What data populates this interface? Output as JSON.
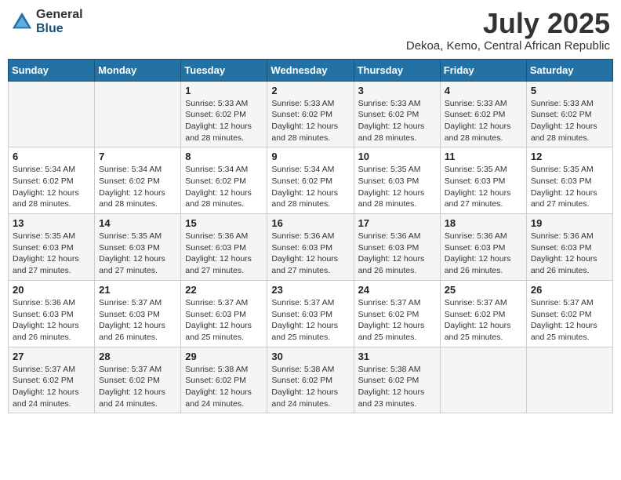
{
  "logo": {
    "general": "General",
    "blue": "Blue"
  },
  "title": "July 2025",
  "subtitle": "Dekoa, Kemo, Central African Republic",
  "weekdays": [
    "Sunday",
    "Monday",
    "Tuesday",
    "Wednesday",
    "Thursday",
    "Friday",
    "Saturday"
  ],
  "weeks": [
    [
      {
        "day": "",
        "info": ""
      },
      {
        "day": "",
        "info": ""
      },
      {
        "day": "1",
        "sunrise": "Sunrise: 5:33 AM",
        "sunset": "Sunset: 6:02 PM",
        "daylight": "Daylight: 12 hours and 28 minutes."
      },
      {
        "day": "2",
        "sunrise": "Sunrise: 5:33 AM",
        "sunset": "Sunset: 6:02 PM",
        "daylight": "Daylight: 12 hours and 28 minutes."
      },
      {
        "day": "3",
        "sunrise": "Sunrise: 5:33 AM",
        "sunset": "Sunset: 6:02 PM",
        "daylight": "Daylight: 12 hours and 28 minutes."
      },
      {
        "day": "4",
        "sunrise": "Sunrise: 5:33 AM",
        "sunset": "Sunset: 6:02 PM",
        "daylight": "Daylight: 12 hours and 28 minutes."
      },
      {
        "day": "5",
        "sunrise": "Sunrise: 5:33 AM",
        "sunset": "Sunset: 6:02 PM",
        "daylight": "Daylight: 12 hours and 28 minutes."
      }
    ],
    [
      {
        "day": "6",
        "sunrise": "Sunrise: 5:34 AM",
        "sunset": "Sunset: 6:02 PM",
        "daylight": "Daylight: 12 hours and 28 minutes."
      },
      {
        "day": "7",
        "sunrise": "Sunrise: 5:34 AM",
        "sunset": "Sunset: 6:02 PM",
        "daylight": "Daylight: 12 hours and 28 minutes."
      },
      {
        "day": "8",
        "sunrise": "Sunrise: 5:34 AM",
        "sunset": "Sunset: 6:02 PM",
        "daylight": "Daylight: 12 hours and 28 minutes."
      },
      {
        "day": "9",
        "sunrise": "Sunrise: 5:34 AM",
        "sunset": "Sunset: 6:02 PM",
        "daylight": "Daylight: 12 hours and 28 minutes."
      },
      {
        "day": "10",
        "sunrise": "Sunrise: 5:35 AM",
        "sunset": "Sunset: 6:03 PM",
        "daylight": "Daylight: 12 hours and 28 minutes."
      },
      {
        "day": "11",
        "sunrise": "Sunrise: 5:35 AM",
        "sunset": "Sunset: 6:03 PM",
        "daylight": "Daylight: 12 hours and 27 minutes."
      },
      {
        "day": "12",
        "sunrise": "Sunrise: 5:35 AM",
        "sunset": "Sunset: 6:03 PM",
        "daylight": "Daylight: 12 hours and 27 minutes."
      }
    ],
    [
      {
        "day": "13",
        "sunrise": "Sunrise: 5:35 AM",
        "sunset": "Sunset: 6:03 PM",
        "daylight": "Daylight: 12 hours and 27 minutes."
      },
      {
        "day": "14",
        "sunrise": "Sunrise: 5:35 AM",
        "sunset": "Sunset: 6:03 PM",
        "daylight": "Daylight: 12 hours and 27 minutes."
      },
      {
        "day": "15",
        "sunrise": "Sunrise: 5:36 AM",
        "sunset": "Sunset: 6:03 PM",
        "daylight": "Daylight: 12 hours and 27 minutes."
      },
      {
        "day": "16",
        "sunrise": "Sunrise: 5:36 AM",
        "sunset": "Sunset: 6:03 PM",
        "daylight": "Daylight: 12 hours and 27 minutes."
      },
      {
        "day": "17",
        "sunrise": "Sunrise: 5:36 AM",
        "sunset": "Sunset: 6:03 PM",
        "daylight": "Daylight: 12 hours and 26 minutes."
      },
      {
        "day": "18",
        "sunrise": "Sunrise: 5:36 AM",
        "sunset": "Sunset: 6:03 PM",
        "daylight": "Daylight: 12 hours and 26 minutes."
      },
      {
        "day": "19",
        "sunrise": "Sunrise: 5:36 AM",
        "sunset": "Sunset: 6:03 PM",
        "daylight": "Daylight: 12 hours and 26 minutes."
      }
    ],
    [
      {
        "day": "20",
        "sunrise": "Sunrise: 5:36 AM",
        "sunset": "Sunset: 6:03 PM",
        "daylight": "Daylight: 12 hours and 26 minutes."
      },
      {
        "day": "21",
        "sunrise": "Sunrise: 5:37 AM",
        "sunset": "Sunset: 6:03 PM",
        "daylight": "Daylight: 12 hours and 26 minutes."
      },
      {
        "day": "22",
        "sunrise": "Sunrise: 5:37 AM",
        "sunset": "Sunset: 6:03 PM",
        "daylight": "Daylight: 12 hours and 25 minutes."
      },
      {
        "day": "23",
        "sunrise": "Sunrise: 5:37 AM",
        "sunset": "Sunset: 6:03 PM",
        "daylight": "Daylight: 12 hours and 25 minutes."
      },
      {
        "day": "24",
        "sunrise": "Sunrise: 5:37 AM",
        "sunset": "Sunset: 6:02 PM",
        "daylight": "Daylight: 12 hours and 25 minutes."
      },
      {
        "day": "25",
        "sunrise": "Sunrise: 5:37 AM",
        "sunset": "Sunset: 6:02 PM",
        "daylight": "Daylight: 12 hours and 25 minutes."
      },
      {
        "day": "26",
        "sunrise": "Sunrise: 5:37 AM",
        "sunset": "Sunset: 6:02 PM",
        "daylight": "Daylight: 12 hours and 25 minutes."
      }
    ],
    [
      {
        "day": "27",
        "sunrise": "Sunrise: 5:37 AM",
        "sunset": "Sunset: 6:02 PM",
        "daylight": "Daylight: 12 hours and 24 minutes."
      },
      {
        "day": "28",
        "sunrise": "Sunrise: 5:37 AM",
        "sunset": "Sunset: 6:02 PM",
        "daylight": "Daylight: 12 hours and 24 minutes."
      },
      {
        "day": "29",
        "sunrise": "Sunrise: 5:38 AM",
        "sunset": "Sunset: 6:02 PM",
        "daylight": "Daylight: 12 hours and 24 minutes."
      },
      {
        "day": "30",
        "sunrise": "Sunrise: 5:38 AM",
        "sunset": "Sunset: 6:02 PM",
        "daylight": "Daylight: 12 hours and 24 minutes."
      },
      {
        "day": "31",
        "sunrise": "Sunrise: 5:38 AM",
        "sunset": "Sunset: 6:02 PM",
        "daylight": "Daylight: 12 hours and 23 minutes."
      },
      {
        "day": "",
        "info": ""
      },
      {
        "day": "",
        "info": ""
      }
    ]
  ]
}
